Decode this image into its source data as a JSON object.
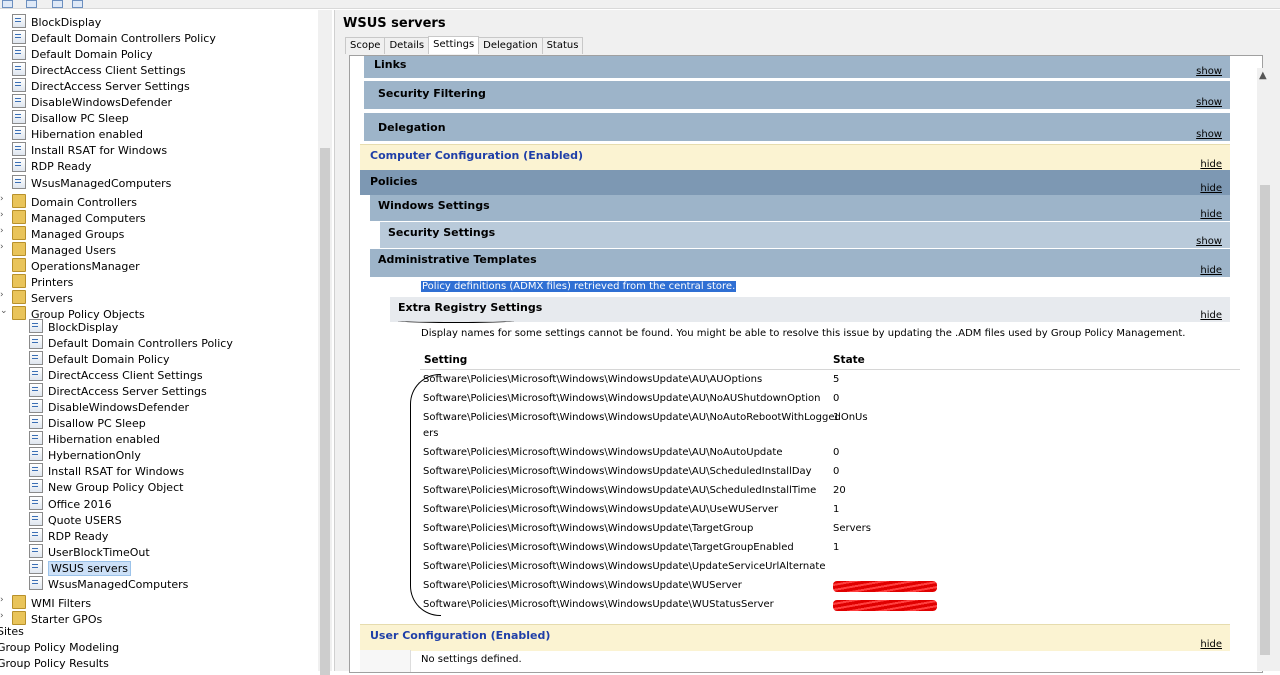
{
  "tree": {
    "items": [
      {
        "label": "BlockDisplay",
        "indent": 12,
        "icon": "gpo-link-icon",
        "expander": ""
      },
      {
        "label": "Default Domain Controllers Policy",
        "indent": 12,
        "icon": "gpo-link-icon",
        "expander": ""
      },
      {
        "label": "Default Domain Policy",
        "indent": 12,
        "icon": "gpo-link-icon",
        "expander": ""
      },
      {
        "label": "DirectAccess Client Settings",
        "indent": 12,
        "icon": "gpo-link-icon",
        "expander": ""
      },
      {
        "label": "DirectAccess Server Settings",
        "indent": 12,
        "icon": "gpo-link-icon",
        "expander": ""
      },
      {
        "label": "DisableWindowsDefender",
        "indent": 12,
        "icon": "gpo-link-icon",
        "expander": ""
      },
      {
        "label": "Disallow PC Sleep",
        "indent": 12,
        "icon": "gpo-link-icon",
        "expander": ""
      },
      {
        "label": "Hibernation enabled",
        "indent": 12,
        "icon": "gpo-link-icon",
        "expander": ""
      },
      {
        "label": "Install RSAT for Windows",
        "indent": 12,
        "icon": "gpo-link-icon",
        "expander": ""
      },
      {
        "label": "RDP Ready",
        "indent": 12,
        "icon": "gpo-link-icon",
        "expander": ""
      },
      {
        "label": "WsusManagedComputers",
        "indent": 12,
        "icon": "gpo-link-icon",
        "expander": ""
      },
      {
        "label": "Domain Controllers",
        "indent": 12,
        "icon": "folder-icon",
        "expander": "›"
      },
      {
        "label": "Managed Computers",
        "indent": 12,
        "icon": "folder-icon",
        "expander": "›"
      },
      {
        "label": "Managed Groups",
        "indent": 12,
        "icon": "folder-icon",
        "expander": "›"
      },
      {
        "label": "Managed Users",
        "indent": 12,
        "icon": "folder-icon",
        "expander": "›"
      },
      {
        "label": "OperationsManager",
        "indent": 12,
        "icon": "folder-icon",
        "expander": ""
      },
      {
        "label": "Printers",
        "indent": 12,
        "icon": "folder-icon",
        "expander": ""
      },
      {
        "label": "Servers",
        "indent": 12,
        "icon": "folder-icon",
        "expander": "›"
      },
      {
        "label": "Group Policy Objects",
        "indent": 12,
        "icon": "folder-icon",
        "expander": "⌄"
      },
      {
        "label": "BlockDisplay",
        "indent": 29,
        "icon": "gpo-icon",
        "expander": ""
      },
      {
        "label": "Default Domain Controllers Policy",
        "indent": 29,
        "icon": "gpo-icon",
        "expander": ""
      },
      {
        "label": "Default Domain Policy",
        "indent": 29,
        "icon": "gpo-icon",
        "expander": ""
      },
      {
        "label": "DirectAccess Client Settings",
        "indent": 29,
        "icon": "gpo-icon",
        "expander": ""
      },
      {
        "label": "DirectAccess Server Settings",
        "indent": 29,
        "icon": "gpo-icon",
        "expander": ""
      },
      {
        "label": "DisableWindowsDefender",
        "indent": 29,
        "icon": "gpo-icon",
        "expander": ""
      },
      {
        "label": "Disallow PC Sleep",
        "indent": 29,
        "icon": "gpo-icon",
        "expander": ""
      },
      {
        "label": "Hibernation enabled",
        "indent": 29,
        "icon": "gpo-icon",
        "expander": ""
      },
      {
        "label": "HybernationOnly",
        "indent": 29,
        "icon": "gpo-icon",
        "expander": ""
      },
      {
        "label": "Install RSAT for Windows",
        "indent": 29,
        "icon": "gpo-icon",
        "expander": ""
      },
      {
        "label": "New Group Policy Object",
        "indent": 29,
        "icon": "gpo-icon",
        "expander": ""
      },
      {
        "label": "Office 2016",
        "indent": 29,
        "icon": "gpo-icon",
        "expander": ""
      },
      {
        "label": "Quote USERS",
        "indent": 29,
        "icon": "gpo-icon",
        "expander": ""
      },
      {
        "label": "RDP Ready",
        "indent": 29,
        "icon": "gpo-icon",
        "expander": ""
      },
      {
        "label": "UserBlockTimeOut",
        "indent": 29,
        "icon": "gpo-icon",
        "expander": ""
      },
      {
        "label": "WSUS servers",
        "indent": 29,
        "icon": "gpo-icon",
        "expander": "",
        "selected": true
      },
      {
        "label": "WsusManagedComputers",
        "indent": 29,
        "icon": "gpo-icon",
        "expander": ""
      },
      {
        "label": "WMI Filters",
        "indent": 12,
        "icon": "folder-icon",
        "expander": "›"
      },
      {
        "label": "Starter GPOs",
        "indent": 12,
        "icon": "folder-icon",
        "expander": "›"
      },
      {
        "label": "Sites",
        "indent": -3,
        "icon": "",
        "expander": ""
      },
      {
        "label": "Group Policy Modeling",
        "indent": -3,
        "icon": "",
        "expander": ""
      },
      {
        "label": "Group Policy Results",
        "indent": -3,
        "icon": "",
        "expander": ""
      }
    ]
  },
  "header": {
    "title": "WSUS servers"
  },
  "tabs": [
    {
      "label": "Scope",
      "active": false
    },
    {
      "label": "Details",
      "active": false
    },
    {
      "label": "Settings",
      "active": true
    },
    {
      "label": "Delegation",
      "active": false
    },
    {
      "label": "Status",
      "active": false
    }
  ],
  "report": {
    "links": {
      "label": "Links",
      "action": "show"
    },
    "security_filtering": {
      "label": "Security Filtering",
      "action": "show"
    },
    "delegation": {
      "label": "Delegation",
      "action": "show"
    },
    "computer_config": {
      "label": "Computer Configuration (Enabled)",
      "action": "hide"
    },
    "policies": {
      "label": "Policies",
      "action": "hide"
    },
    "windows_settings": {
      "label": "Windows Settings",
      "action": "hide"
    },
    "security_settings": {
      "label": "Security Settings",
      "action": "show"
    },
    "admin_templates": {
      "label": "Administrative Templates",
      "action": "hide"
    },
    "policy_definitions": "Policy definitions (ADMX files) retrieved from the central store.",
    "extra_registry": {
      "label": "Extra Registry Settings",
      "action": "hide"
    },
    "note": "Display names for some settings cannot be found. You might be able to resolve this issue by updating the .ADM files used by Group Policy Management.",
    "table": {
      "headers": {
        "setting": "Setting",
        "state": "State"
      },
      "rows": [
        {
          "setting": "Software\\Policies\\Microsoft\\Windows\\WindowsUpdate\\AU\\AUOptions",
          "state": "5"
        },
        {
          "setting": "Software\\Policies\\Microsoft\\Windows\\WindowsUpdate\\AU\\NoAUShutdownOption",
          "state": "0"
        },
        {
          "setting": "Software\\Policies\\Microsoft\\Windows\\WindowsUpdate\\AU\\NoAutoRebootWithLoggedOnUs",
          "cont": "ers",
          "state": "1"
        },
        {
          "setting": "Software\\Policies\\Microsoft\\Windows\\WindowsUpdate\\AU\\NoAutoUpdate",
          "state": "0"
        },
        {
          "setting": "Software\\Policies\\Microsoft\\Windows\\WindowsUpdate\\AU\\ScheduledInstallDay",
          "state": "0"
        },
        {
          "setting": "Software\\Policies\\Microsoft\\Windows\\WindowsUpdate\\AU\\ScheduledInstallTime",
          "state": "20"
        },
        {
          "setting": "Software\\Policies\\Microsoft\\Windows\\WindowsUpdate\\AU\\UseWUServer",
          "state": "1"
        },
        {
          "setting": "Software\\Policies\\Microsoft\\Windows\\WindowsUpdate\\TargetGroup",
          "state": "Servers"
        },
        {
          "setting": "Software\\Policies\\Microsoft\\Windows\\WindowsUpdate\\TargetGroupEnabled",
          "state": "1"
        },
        {
          "setting": "Software\\Policies\\Microsoft\\Windows\\WindowsUpdate\\UpdateServiceUrlAlternate",
          "state": ""
        },
        {
          "setting": "Software\\Policies\\Microsoft\\Windows\\WindowsUpdate\\WUServer",
          "state": "",
          "redacted": true
        },
        {
          "setting": "Software\\Policies\\Microsoft\\Windows\\WindowsUpdate\\WUStatusServer",
          "state": "",
          "redacted": true
        }
      ]
    },
    "user_config": {
      "label": "User Configuration (Enabled)",
      "action": "hide"
    },
    "no_settings": "No settings defined."
  },
  "colors": {
    "accent_blue": "#1f3fa8",
    "highlight": "#2f6fd3",
    "annotation_red": "#cc0000"
  }
}
